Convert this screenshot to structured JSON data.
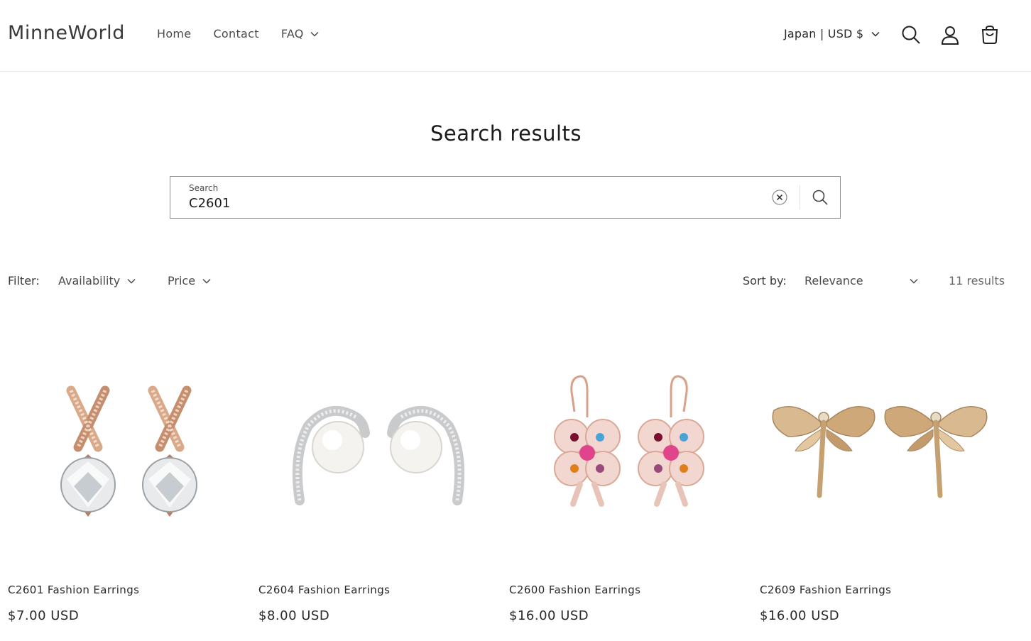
{
  "header": {
    "logo": "MinneWorld",
    "nav": [
      {
        "label": "Home"
      },
      {
        "label": "Contact"
      },
      {
        "label": "FAQ"
      }
    ],
    "locale": "Japan | USD $",
    "icons": [
      "search-icon",
      "account-icon",
      "cart-icon"
    ]
  },
  "page": {
    "title": "Search results"
  },
  "search": {
    "label": "Search",
    "value": "C2601"
  },
  "filters": {
    "label": "Filter:",
    "availability": "Availability",
    "price": "Price",
    "sort_label": "Sort by:",
    "sort_value": "Relevance",
    "results_count": "11 results"
  },
  "products": [
    {
      "name": "C2601 Fashion Earrings",
      "price": "$7.00 USD"
    },
    {
      "name": "C2604 Fashion Earrings",
      "price": "$8.00 USD"
    },
    {
      "name": "C2600 Fashion Earrings",
      "price": "$16.00 USD"
    },
    {
      "name": "C2609 Fashion Earrings",
      "price": "$16.00 USD"
    }
  ]
}
